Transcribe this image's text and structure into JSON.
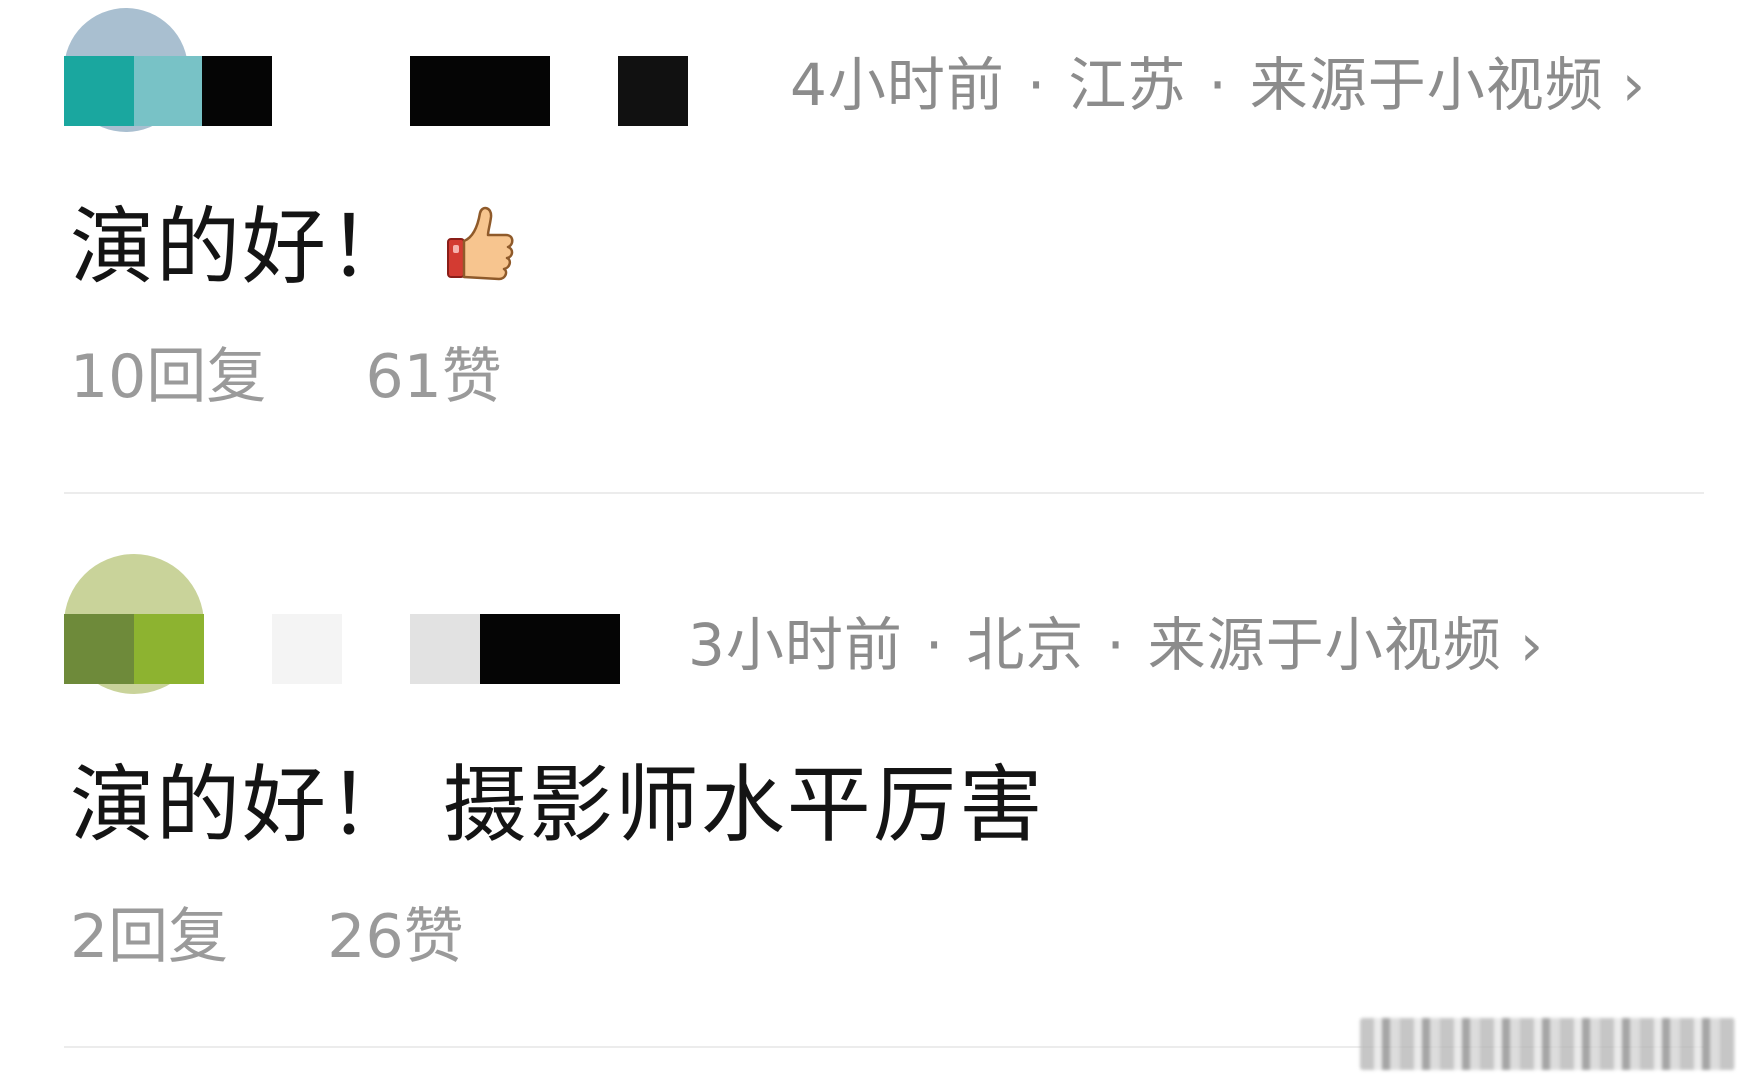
{
  "comments": [
    {
      "meta": {
        "time": "4小时前",
        "location": "江苏",
        "source": "来源于小视频",
        "chevron": "›"
      },
      "text": "演的好！",
      "has_thumbs_up": true,
      "replies": "10回复",
      "likes": "61赞"
    },
    {
      "meta": {
        "time": "3小时前",
        "location": "北京",
        "source": "来源于小视频",
        "chevron": "›"
      },
      "text": "演的好！ 摄影师水平厉害",
      "has_thumbs_up": false,
      "replies": "2回复",
      "likes": "26赞"
    }
  ],
  "separator": "·",
  "colors": {
    "meta": "#8c8c8c",
    "text": "#141414",
    "stats": "#9a9a9a"
  }
}
